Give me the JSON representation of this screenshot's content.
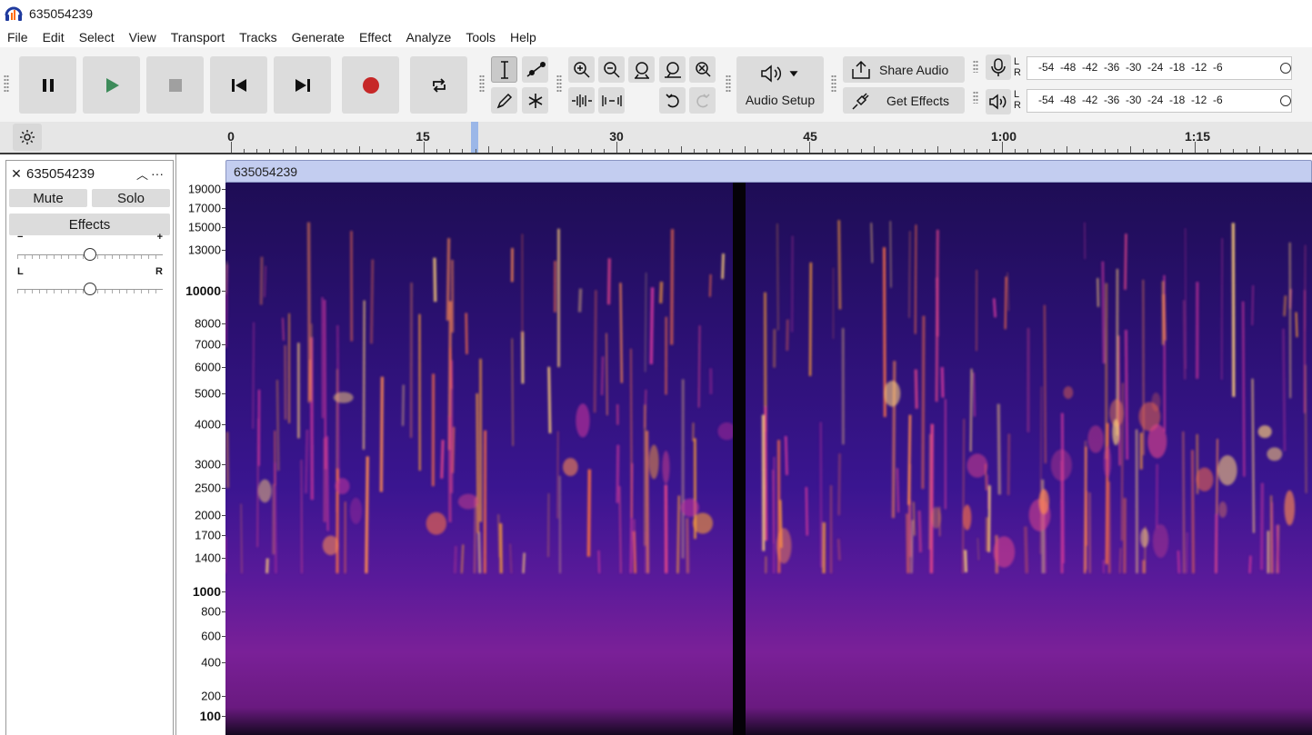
{
  "window": {
    "title": "635054239"
  },
  "menu": [
    "File",
    "Edit",
    "Select",
    "View",
    "Transport",
    "Tracks",
    "Generate",
    "Effect",
    "Analyze",
    "Tools",
    "Help"
  ],
  "transport": {
    "icons": [
      "pause-icon",
      "play-icon",
      "stop-icon",
      "skip-to-start-icon",
      "skip-to-end-icon",
      "record-icon",
      "loop-icon"
    ]
  },
  "tools": {
    "active": "selection-tool",
    "items": [
      "selection-tool",
      "envelope-tool",
      "draw-tool",
      "multi-tool"
    ]
  },
  "edit": {
    "items": [
      "zoom-in-icon",
      "zoom-out-icon",
      "fit-selection-icon",
      "fit-project-icon",
      "zoom-toggle-icon",
      "trim-outside-icon",
      "silence-selection-icon",
      "undo-icon",
      "redo-icon"
    ]
  },
  "audio_setup": {
    "label": "Audio Setup"
  },
  "share": {
    "share_label": "Share Audio",
    "effects_label": "Get Effects"
  },
  "meters": {
    "record": {
      "channels": "L R",
      "ticks": [
        "-54",
        "-48",
        "-42",
        "-36",
        "-30",
        "-24",
        "-18",
        "-12",
        "-6"
      ]
    },
    "playback": {
      "channels": "L R",
      "ticks": [
        "-54",
        "-48",
        "-42",
        "-36",
        "-30",
        "-24",
        "-18",
        "-12",
        "-6"
      ]
    }
  },
  "timeline": {
    "labels": [
      "0",
      "15",
      "30",
      "45",
      "1:00",
      "1:15"
    ]
  },
  "track": {
    "name": "635054239",
    "mute_label": "Mute",
    "solo_label": "Solo",
    "effects_label": "Effects",
    "gain": {
      "min_label": "−",
      "max_label": "+",
      "value": 0.5
    },
    "pan": {
      "left_label": "L",
      "right_label": "R",
      "value": 0.5
    }
  },
  "clip": {
    "name": "635054239"
  },
  "frequency_axis": {
    "labels": [
      "19000",
      "17000",
      "15000",
      "13000",
      "10000",
      "8000",
      "7000",
      "6000",
      "5000",
      "4000",
      "3000",
      "2500",
      "2000",
      "1700",
      "1400",
      "1000",
      "800",
      "600",
      "400",
      "200",
      "100"
    ],
    "bold": [
      "10000",
      "1000",
      "100"
    ]
  },
  "colors": {
    "clip_header": "#c3cdf0",
    "spectrogram_base": "#2a0f5a",
    "accent_blue": "#9bb7e8",
    "record_red": "#c62828",
    "play_green": "#3d8b5a"
  }
}
